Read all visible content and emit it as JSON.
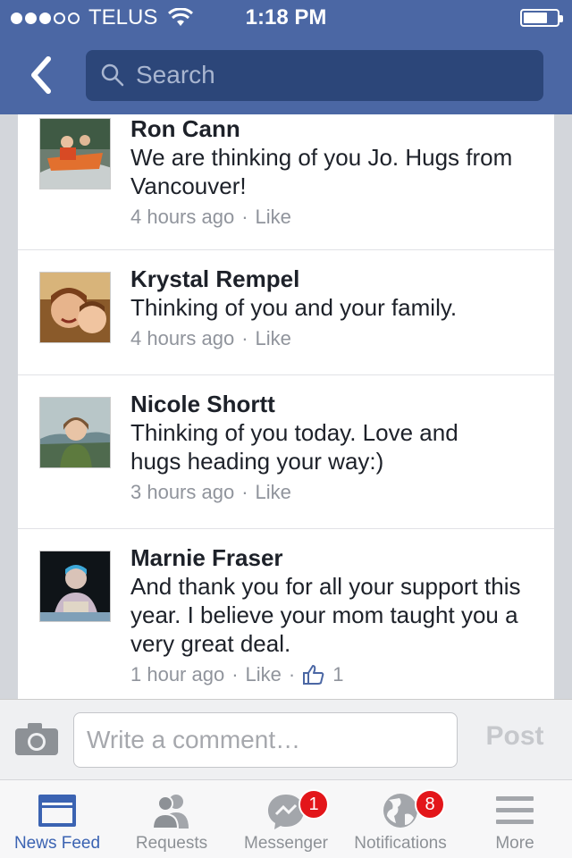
{
  "status_bar": {
    "carrier": "TELUS",
    "time": "1:18 PM",
    "signal_bars": 3,
    "signal_max": 5
  },
  "nav": {
    "search_placeholder": "Search"
  },
  "comments": [
    {
      "name": "Ron Cann",
      "text": "We are thinking of you Jo. Hugs from Vancouver!",
      "time": "4 hours ago",
      "like": "Like"
    },
    {
      "name": "Krystal Rempel",
      "text": "Thinking of you and your family.",
      "time": "4 hours ago",
      "like": "Like"
    },
    {
      "name": "Nicole Shortt",
      "text": "Thinking of you today.  Love and hugs heading your way:)",
      "time": "3 hours ago",
      "like": "Like"
    },
    {
      "name": "Marnie Fraser",
      "text": "And thank you for all your support this year.  I believe your mom taught you a very great deal.",
      "time": "1 hour ago",
      "like": "Like",
      "like_count": "1"
    }
  ],
  "composer": {
    "placeholder": "Write a comment…",
    "post_label": "Post"
  },
  "tabs": [
    {
      "label": "News Feed",
      "icon": "news-feed-icon",
      "active": true
    },
    {
      "label": "Requests",
      "icon": "requests-icon"
    },
    {
      "label": "Messenger",
      "icon": "messenger-icon",
      "badge": "1"
    },
    {
      "label": "Notifications",
      "icon": "globe-icon",
      "badge": "8"
    },
    {
      "label": "More",
      "icon": "menu-icon"
    }
  ],
  "colors": {
    "brand": "#4b67a4",
    "search_bg": "#2c4679",
    "active_tab": "#3b63b2",
    "badge": "#e3161a"
  }
}
